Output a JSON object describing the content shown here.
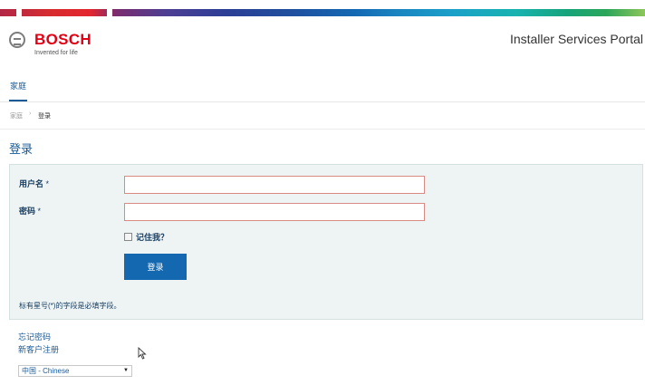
{
  "brand": {
    "logo_text": "BOSCH",
    "tagline": "Invented for life",
    "color": "#e20015"
  },
  "header": {
    "portal_title": "Installer Services Portal"
  },
  "nav": {
    "tabs": [
      {
        "label": "家庭",
        "active": true
      }
    ]
  },
  "breadcrumb": {
    "home": "家庭",
    "separator": "›",
    "current": "登录"
  },
  "page": {
    "title": "登录"
  },
  "form": {
    "username": {
      "label": "用户名",
      "required_mark": "*",
      "value": ""
    },
    "password": {
      "label": "密码",
      "required_mark": "*",
      "value": ""
    },
    "remember_me": {
      "label": "记住我？",
      "checked": false
    },
    "submit_label": "登录",
    "required_note": "标有星号(*)的字段是必填字段。"
  },
  "links": {
    "forgot_password": "忘记密码",
    "register": "新客户注册"
  },
  "language": {
    "selected": "中国 - Chinese"
  },
  "colors": {
    "accent": "#1468b0",
    "panel_bg": "#eef4f4",
    "input_border": "#d98a82"
  },
  "icons": {
    "logo": "bosch-armature-icon",
    "cursor": "mouse-pointer-icon",
    "dropdown": "caret-down-icon"
  }
}
